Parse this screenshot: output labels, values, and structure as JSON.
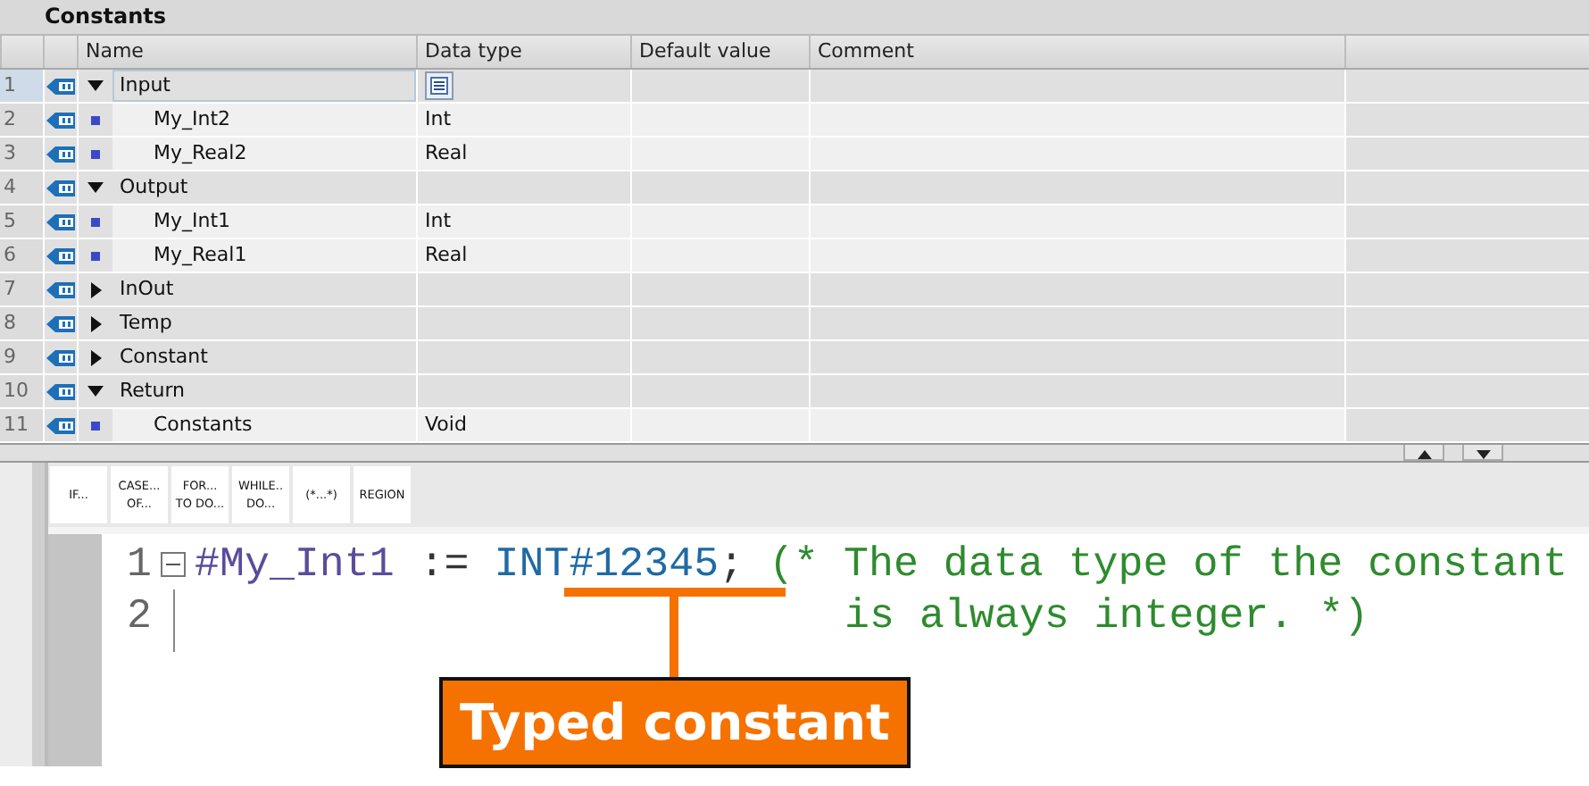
{
  "panel": {
    "title": "Constants"
  },
  "table": {
    "columns": [
      "Name",
      "Data type",
      "Default value",
      "Comment"
    ],
    "rows": [
      {
        "number": "1",
        "kind": "group",
        "name": "Input",
        "expanded": true,
        "focused": true,
        "data_type": ""
      },
      {
        "number": "2",
        "kind": "member",
        "name": "My_Int2",
        "focused": false,
        "data_type": "Int"
      },
      {
        "number": "3",
        "kind": "member",
        "name": "My_Real2",
        "focused": false,
        "data_type": "Real"
      },
      {
        "number": "4",
        "kind": "group",
        "name": "Output",
        "expanded": true,
        "focused": false,
        "data_type": ""
      },
      {
        "number": "5",
        "kind": "member",
        "name": "My_Int1",
        "focused": false,
        "data_type": "Int"
      },
      {
        "number": "6",
        "kind": "member",
        "name": "My_Real1",
        "focused": false,
        "data_type": "Real"
      },
      {
        "number": "7",
        "kind": "group",
        "name": "InOut",
        "expanded": false,
        "focused": false,
        "data_type": ""
      },
      {
        "number": "8",
        "kind": "group",
        "name": "Temp",
        "expanded": false,
        "focused": false,
        "data_type": ""
      },
      {
        "number": "9",
        "kind": "group",
        "name": "Constant",
        "expanded": false,
        "focused": false,
        "data_type": ""
      },
      {
        "number": "10",
        "kind": "group",
        "name": "Return",
        "expanded": true,
        "focused": false,
        "data_type": ""
      },
      {
        "number": "11",
        "kind": "member",
        "name": "Constants",
        "focused": false,
        "data_type": "Void"
      }
    ]
  },
  "toolbar": [
    "IF...",
    "CASE...\nOF...",
    "FOR...\nTO DO...",
    "WHILE..\nDO...",
    "(*...*)",
    "REGION"
  ],
  "editor": {
    "lines": [
      {
        "number": "1",
        "fold": true,
        "tokens": [
          {
            "kind": "variable",
            "text": "#My_Int1"
          },
          {
            "kind": "operator",
            "text": " := "
          },
          {
            "kind": "constant",
            "text": "INT#12345"
          },
          {
            "kind": "operator",
            "text": "; "
          },
          {
            "kind": "comment",
            "text": "(* The data type of the constant"
          }
        ]
      },
      {
        "number": "2",
        "fold": false,
        "tokens": [
          {
            "kind": "comment-continuation",
            "text": "is always integer. *)"
          }
        ]
      }
    ]
  },
  "callout": {
    "text": "Typed constant"
  }
}
